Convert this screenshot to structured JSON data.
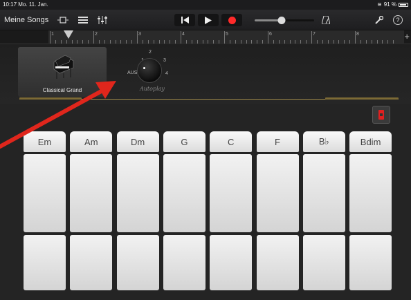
{
  "status": {
    "time": "10:17",
    "date": "Mo. 11. Jan.",
    "battery": "91 %"
  },
  "toolbar": {
    "my_songs": "Meine Songs",
    "icons": [
      "view-toggle-icon",
      "tracks-icon",
      "mixer-icon",
      "rewind-icon",
      "play-icon",
      "record-icon",
      "metronome-icon",
      "wrench-icon",
      "help-icon"
    ],
    "volume_level": 0.45,
    "help_label": "?"
  },
  "ruler": {
    "bars": [
      "1",
      "2",
      "3",
      "4",
      "5",
      "6",
      "7",
      "8"
    ],
    "add_label": "+"
  },
  "instrument": {
    "name": "Classical Grand"
  },
  "autoplay": {
    "title": "Autoplay",
    "off_label": "AUS",
    "positions": [
      "1",
      "2",
      "3",
      "4"
    ]
  },
  "chords": [
    "Em",
    "Am",
    "Dm",
    "G",
    "C",
    "F",
    "B♭",
    "Bdim"
  ],
  "colors": {
    "record": "#ff2a2a",
    "accent_gold": "#a08a4a",
    "annotation_arrow": "#e0261c"
  }
}
